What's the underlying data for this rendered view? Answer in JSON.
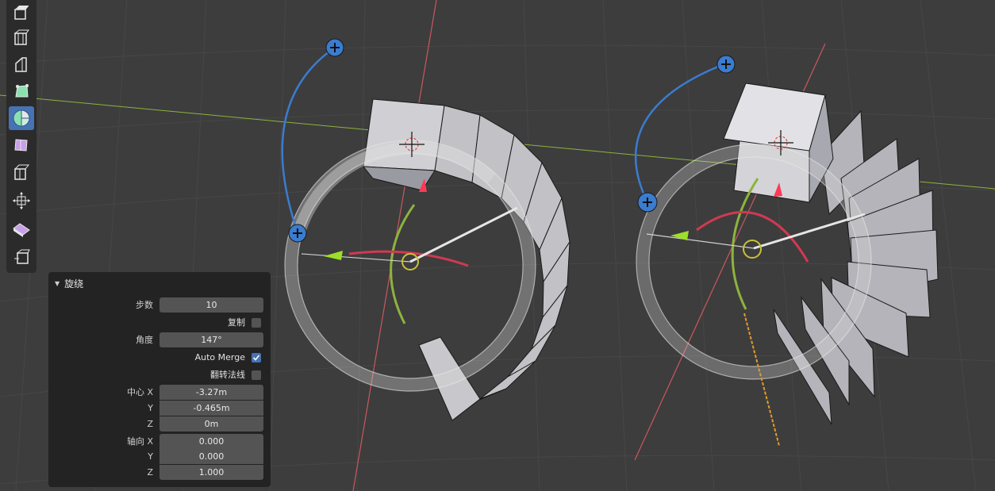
{
  "toolbar": {
    "tools": [
      {
        "icon": "extrude-region-icon",
        "active": false
      },
      {
        "icon": "inset-faces-icon",
        "active": false
      },
      {
        "icon": "bevel-icon",
        "active": false
      },
      {
        "icon": "loop-cut-icon",
        "active": false
      },
      {
        "icon": "spin-icon",
        "active": true
      },
      {
        "icon": "smooth-vertices-icon",
        "active": false
      },
      {
        "icon": "edge-slide-icon",
        "active": false
      },
      {
        "icon": "shrink-fatten-icon",
        "active": false
      },
      {
        "icon": "shear-icon",
        "active": false
      },
      {
        "icon": "rip-region-icon",
        "active": false
      }
    ],
    "active_color": "#4772b3"
  },
  "operator_panel": {
    "title": "旋绕",
    "steps": {
      "label": "步数",
      "value": "10"
    },
    "duplicate": {
      "label": "复制",
      "checked": false
    },
    "angle": {
      "label": "角度",
      "value": "147°"
    },
    "auto_merge": {
      "label": "Auto Merge",
      "checked": true
    },
    "flip_normals": {
      "label": "翻转法线",
      "checked": false
    },
    "center": {
      "label": "中心 X",
      "x": "-3.27m",
      "y_label": "Y",
      "y": "-0.465m",
      "z_label": "Z",
      "z": "0m"
    },
    "axis": {
      "label": "轴向 X",
      "x": "0.000",
      "y_label": "Y",
      "y": "0.000",
      "z_label": "Z",
      "z": "1.000"
    }
  },
  "viewport": {
    "background": "#3d3d3d",
    "grid_color": "#4a4a4a",
    "x_axis_color": "#c9575f",
    "y_axis_color": "#8db33d",
    "gizmo_blue": "#3a7ccf",
    "gizmo_red": "#cf3a52",
    "gizmo_green": "#8db33d",
    "gizmo_yellow": "#c9c23a",
    "orange_axis": "#e39a2b"
  }
}
